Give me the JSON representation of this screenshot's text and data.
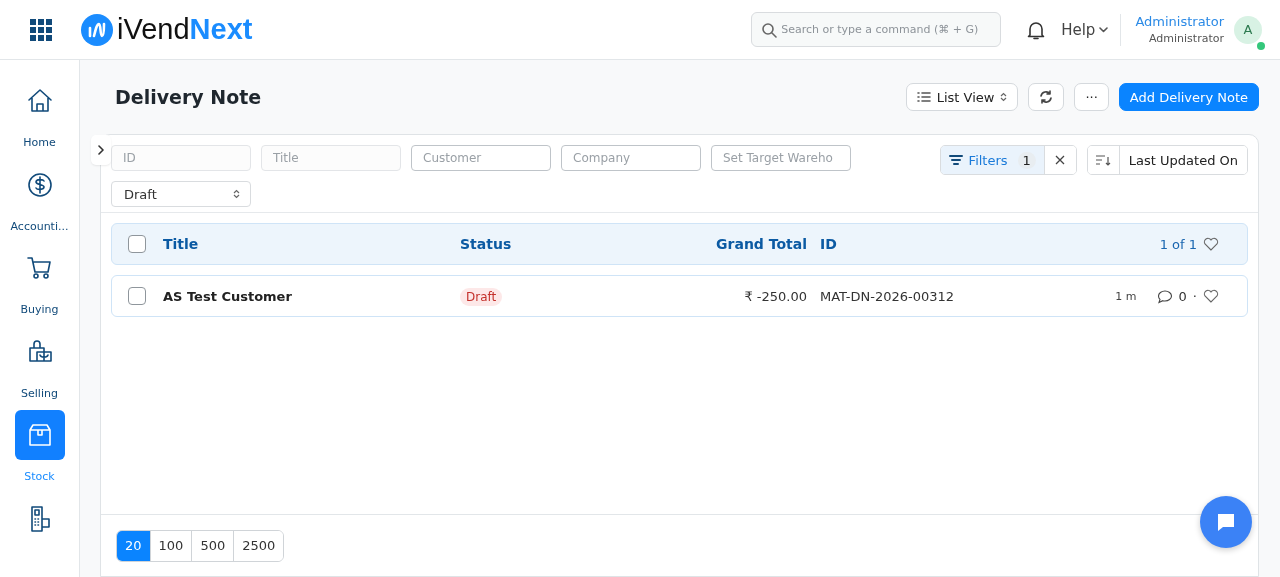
{
  "header": {
    "brand": {
      "plain": "iVend",
      "accent": "Next"
    },
    "search": {
      "placeholder": "Search or type a command (⌘ + G)"
    },
    "help": "Help",
    "user": {
      "name": "Administrator",
      "role": "Administrator",
      "initial": "A",
      "online": true
    }
  },
  "sidebar": {
    "items": [
      {
        "label": "Home",
        "selected": false
      },
      {
        "label": "Accounti...",
        "selected": false
      },
      {
        "label": "Buying",
        "selected": false
      },
      {
        "label": "Selling",
        "selected": false
      },
      {
        "label": "Stock",
        "selected": true
      },
      {
        "selected": false
      }
    ]
  },
  "page": {
    "title": "Delivery Note",
    "view_button": "List View",
    "more_button": "···",
    "primary_button": "Add Delivery Note"
  },
  "filters": {
    "fields": [
      {
        "placeholder": "ID",
        "kind": "data"
      },
      {
        "placeholder": "Title",
        "kind": "data"
      },
      {
        "placeholder": "Customer",
        "kind": "link"
      },
      {
        "placeholder": "Company",
        "kind": "link"
      },
      {
        "placeholder": "Set Target Wareho",
        "kind": "link"
      },
      {
        "value": "Draft",
        "kind": "select"
      }
    ],
    "filter_button": "Filters",
    "filter_count": "1",
    "sort_button": "Last Updated On"
  },
  "table": {
    "columns": [
      "Title",
      "Status",
      "Grand Total",
      "ID"
    ],
    "count": "1 of 1",
    "header_checked": false,
    "rows": [
      {
        "checked": false,
        "title": "AS Test Customer",
        "status": "Draft",
        "grand_total": "₹ -250.00",
        "id": "MAT-DN-2026-00312",
        "modified": "1 m",
        "comments": "0",
        "separator": "·"
      }
    ]
  },
  "paging": [
    {
      "label": "20",
      "selected": true
    },
    {
      "label": "100",
      "selected": false
    },
    {
      "label": "500",
      "selected": false
    },
    {
      "label": "2500",
      "selected": false
    }
  ]
}
